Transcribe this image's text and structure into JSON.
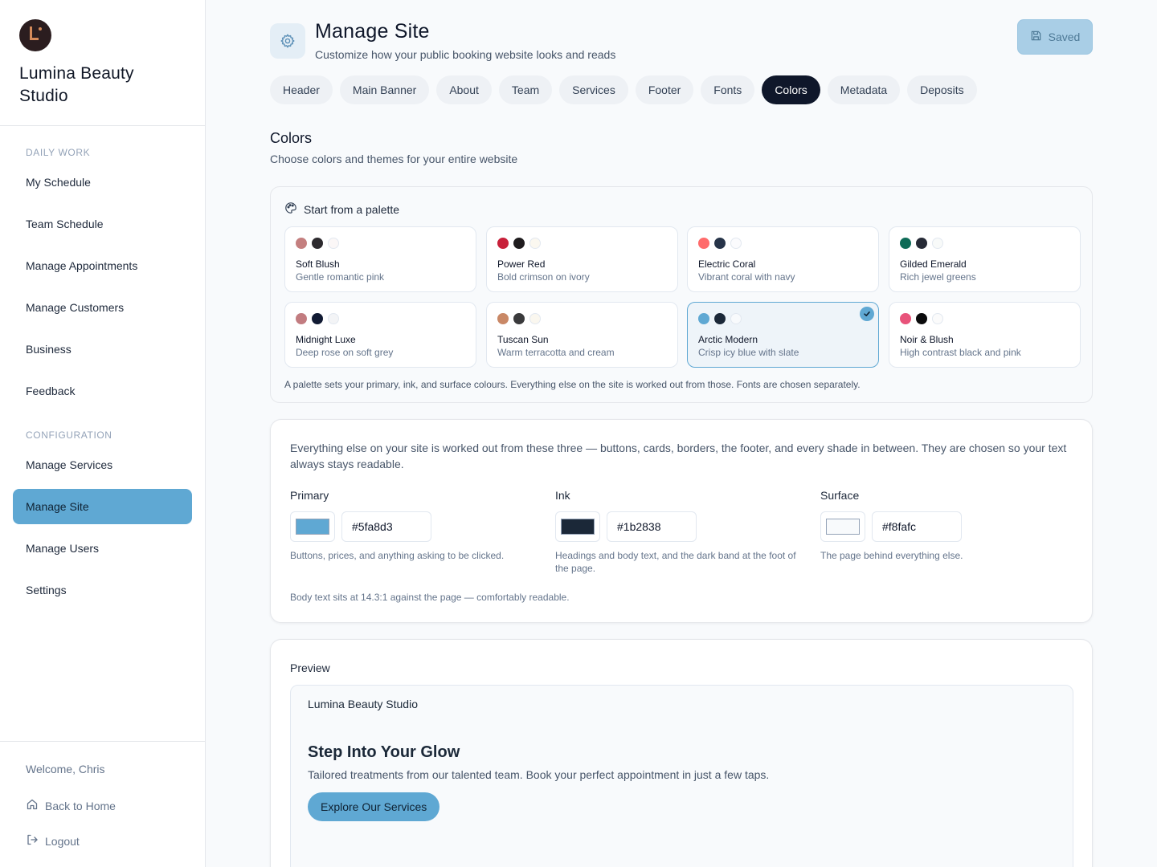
{
  "brand": {
    "name": "Lumina Beauty Studio"
  },
  "sidebar": {
    "sections": [
      {
        "title": "DAILY WORK",
        "items": [
          "My Schedule",
          "Team Schedule",
          "Manage Appointments",
          "Manage Customers",
          "Business",
          "Feedback"
        ]
      },
      {
        "title": "CONFIGURATION",
        "items": [
          "Manage Services",
          "Manage Site",
          "Manage Users",
          "Settings"
        ]
      }
    ],
    "active_item": "Manage Site",
    "welcome": "Welcome, Chris",
    "back_home": "Back to Home",
    "logout": "Logout"
  },
  "header": {
    "title": "Manage Site",
    "subtitle": "Customize how your public booking website looks and reads",
    "saved_label": "Saved"
  },
  "tabs": [
    "Header",
    "Main Banner",
    "About",
    "Team",
    "Services",
    "Footer",
    "Fonts",
    "Colors",
    "Metadata",
    "Deposits"
  ],
  "active_tab": "Colors",
  "section": {
    "title": "Colors",
    "subtitle": "Choose colors and themes for your entire website"
  },
  "palettes": {
    "heading": "Start from a palette",
    "items": [
      {
        "name": "Soft Blush",
        "desc": "Gentle romantic pink",
        "colors": [
          "#c47f7f",
          "#2d2a2e",
          "#fbf7f7"
        ]
      },
      {
        "name": "Power Red",
        "desc": "Bold crimson on ivory",
        "colors": [
          "#c8203a",
          "#1f1c1e",
          "#fbf8f0"
        ]
      },
      {
        "name": "Electric Coral",
        "desc": "Vibrant coral with navy",
        "colors": [
          "#ff6b6b",
          "#273449",
          "#fbfbfd"
        ]
      },
      {
        "name": "Gilded Emerald",
        "desc": "Rich jewel greens",
        "colors": [
          "#0e6b57",
          "#262a36",
          "#f8faf9"
        ]
      },
      {
        "name": "Midnight Luxe",
        "desc": "Deep rose on soft grey",
        "colors": [
          "#c27c80",
          "#111a33",
          "#f3f4f6"
        ]
      },
      {
        "name": "Tuscan Sun",
        "desc": "Warm terracotta and cream",
        "colors": [
          "#c98866",
          "#3a3a3c",
          "#faf7ef"
        ]
      },
      {
        "name": "Arctic Modern",
        "desc": "Crisp icy blue with slate",
        "colors": [
          "#5fa8d3",
          "#1b2838",
          "#f8fafc"
        ],
        "selected": true
      },
      {
        "name": "Noir & Blush",
        "desc": "High contrast black and pink",
        "colors": [
          "#e8537a",
          "#0b0b0c",
          "#fbfbfb"
        ]
      }
    ],
    "note": "A palette sets your primary, ink, and surface colours. Everything else on the site is worked out from those. Fonts are chosen separately."
  },
  "colors": {
    "intro": "Everything else on your site is worked out from these three — buttons, cards, borders, the footer, and every shade in between. They are chosen so your text always stays readable.",
    "fields": [
      {
        "label": "Primary",
        "value": "#5fa8d3",
        "help": "Buttons, prices, and anything asking to be clicked."
      },
      {
        "label": "Ink",
        "value": "#1b2838",
        "help": "Headings and body text, and the dark band at the foot of the page."
      },
      {
        "label": "Surface",
        "value": "#f8fafc",
        "help": "The page behind everything else."
      }
    ],
    "contrast_note": "Body text sits at 14.3:1 against the page — comfortably readable."
  },
  "preview": {
    "label": "Preview",
    "site_name": "Lumina Beauty Studio",
    "title": "Step Into Your Glow",
    "text": "Tailored treatments from our talented team. Book your perfect appointment in just a few taps.",
    "button": "Explore Our Services"
  }
}
